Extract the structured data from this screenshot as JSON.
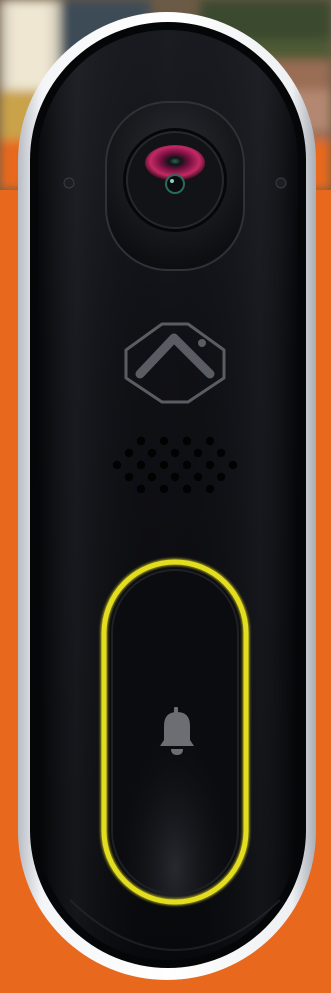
{
  "scene": {
    "subject": "video-doorbell",
    "background_color": "#e8691e",
    "photo_strip_colors": [
      "#3b4a2e",
      "#8a6a52",
      "#c9b48a",
      "#5e3d2b"
    ]
  },
  "doorbell": {
    "housing_color": "#e9ebee",
    "faceplate_color": "#0c0d11",
    "lens_color": "#b0205a",
    "button_ring_color": "#e3dd20",
    "bell_color": "#6d6e74",
    "logo_color": "#5a5c63",
    "icons": {
      "camera": "camera-lens-icon",
      "logo": "brand-logo-icon",
      "speaker": "speaker-grille-icon",
      "bell": "bell-icon"
    }
  }
}
